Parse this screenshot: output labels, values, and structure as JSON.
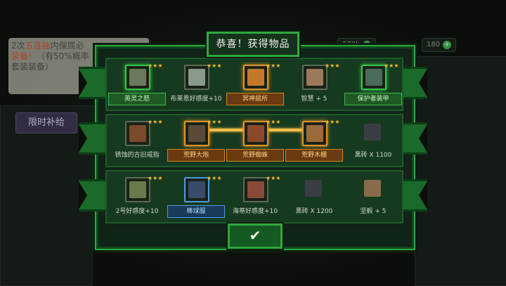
{
  "background": {
    "tip_lines": [
      "2次",
      "五连抽",
      "内保底必",
      "装备！（有50%概率",
      "套装装备）"
    ],
    "chip": "限时补给",
    "currency": [
      {
        "label": "270k"
      },
      {
        "label": "180"
      }
    ]
  },
  "modal": {
    "title": "恭喜！获得物品",
    "confirm_icon": "checkmark-icon"
  },
  "rows": [
    {
      "items": [
        {
          "label": "英灵之怒",
          "style": "green",
          "icon": "axe-icon",
          "slot": "green"
        },
        {
          "label": "布莱恩好感度+10",
          "style": "plain",
          "icon": "character-portrait-icon",
          "slot": "plain"
        },
        {
          "label": "冥神居所",
          "style": "orange",
          "icon": "pyramid-icon",
          "slot": "orange"
        },
        {
          "label": "智慧 + 5",
          "style": "plain",
          "icon": "brain-icon",
          "slot": "plain"
        },
        {
          "label": "保护者装甲",
          "style": "green",
          "icon": "armor-icon",
          "slot": "green"
        }
      ]
    },
    {
      "items": [
        {
          "label": "锈蚀的古旧戒指",
          "style": "plain",
          "icon": "ring-icon",
          "slot": "plain"
        },
        {
          "label": "荒野大炮",
          "style": "orange",
          "icon": "cannon-icon",
          "slot": "orange"
        },
        {
          "label": "荒野蜘蛛",
          "style": "orange",
          "icon": "spider-icon",
          "slot": "orange"
        },
        {
          "label": "荒野木棚",
          "style": "orange",
          "icon": "shed-icon",
          "slot": "orange"
        },
        {
          "label": "黑砖 X 1100",
          "style": "plain",
          "icon": "black-brick-icon",
          "slot": "none"
        }
      ]
    },
    {
      "items": [
        {
          "label": "2号好感度+10",
          "style": "plain",
          "icon": "dinosaur-portrait-icon",
          "slot": "plain"
        },
        {
          "label": "棒球服",
          "style": "blue",
          "icon": "jersey-icon",
          "slot": "blue"
        },
        {
          "label": "海蒂好感度+10",
          "style": "plain",
          "icon": "girl-portrait-icon",
          "slot": "plain"
        },
        {
          "label": "黑砖 X 1200",
          "style": "plain",
          "icon": "black-brick-icon",
          "slot": "none"
        },
        {
          "label": "坚毅 + 5",
          "style": "plain",
          "icon": "shield-heart-icon",
          "slot": "none"
        }
      ]
    }
  ],
  "colors": {
    "frame_green": "#2fa83e",
    "legendary_orange": "#e0932a",
    "epic_green": "#39c24b",
    "rare_blue": "#4a9adf",
    "star_gold": "#f5b731"
  }
}
